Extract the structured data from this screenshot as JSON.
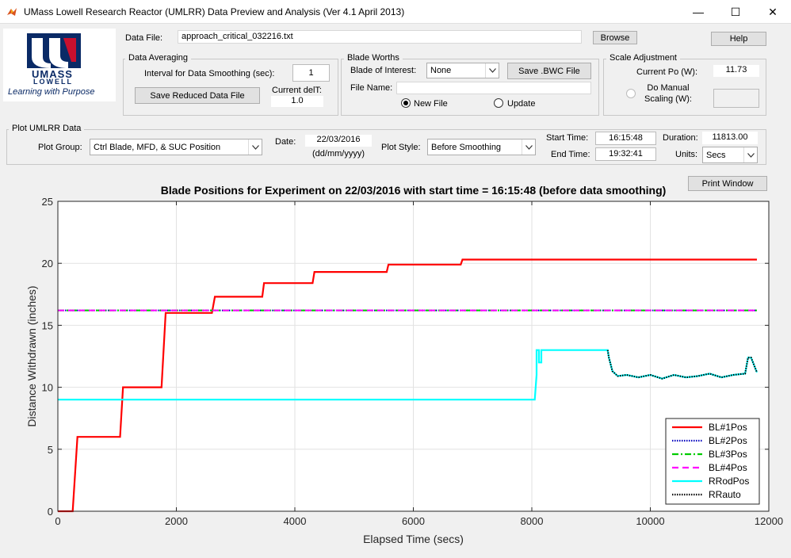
{
  "window": {
    "title": "UMass Lowell Research Reactor (UMLRR) Data Preview and Analysis (Ver 4.1 April 2013)",
    "minimize": "—",
    "maximize": "☐",
    "close": "✕"
  },
  "logo": {
    "text_top": "UMASS",
    "text_bottom": "LOWELL",
    "tagline": "Learning with Purpose"
  },
  "data_file": {
    "label": "Data File:",
    "value": "approach_critical_032216.txt",
    "browse": "Browse",
    "help": "Help"
  },
  "data_averaging": {
    "title": "Data Averaging",
    "interval_label": "Interval for Data Smoothing (sec):",
    "interval_value": "1",
    "save_button": "Save Reduced Data File",
    "current_delt_label": "Current delT:",
    "current_delt_value": "1.0"
  },
  "blade_worths": {
    "title": "Blade Worths",
    "blade_label": "Blade of Interest:",
    "blade_value": "None",
    "save_bwc": "Save .BWC File",
    "file_name_label": "File Name:",
    "file_name_value": "",
    "new_file": "New File",
    "update": "Update"
  },
  "scale_adjustment": {
    "title": "Scale Adjustment",
    "current_po_label": "Current Po (W):",
    "current_po_value": "11.73",
    "manual_label_1": "Do Manual",
    "manual_label_2": "Scaling (W):",
    "manual_value": ""
  },
  "plot_umlrr": {
    "title": "Plot UMLRR Data",
    "plot_group_label": "Plot Group:",
    "plot_group_value": "Ctrl Blade, MFD, & SUC Position",
    "date_label": "Date:",
    "date_value": "22/03/2016",
    "date_format": "(dd/mm/yyyy)",
    "plot_style_label": "Plot Style:",
    "plot_style_value": "Before Smoothing",
    "start_time_label": "Start Time:",
    "start_time_value": "16:15:48",
    "end_time_label": "End Time:",
    "end_time_value": "19:32:41",
    "duration_label": "Duration:",
    "duration_value": "11813.00",
    "units_label": "Units:",
    "units_value": "Secs",
    "print_window": "Print Window"
  },
  "icons": [
    "matlab-app-icon",
    "chevron-down-icon",
    "radio-icon"
  ],
  "chart_data": {
    "type": "line",
    "title": "Blade Positions for Experiment on 22/03/2016 with start time = 16:15:48 (before data smoothing)",
    "xlabel": "Elapsed Time (secs)",
    "ylabel": "Distance Withdrawn (inches)",
    "xlim": [
      0,
      12000
    ],
    "ylim": [
      0,
      25
    ],
    "xticks": [
      0,
      2000,
      4000,
      6000,
      8000,
      10000,
      12000
    ],
    "yticks": [
      0,
      5,
      10,
      15,
      20,
      25
    ],
    "grid": true,
    "legend_position": "bottom-right",
    "series": [
      {
        "name": "BL#1Pos",
        "color": "#ff0000",
        "style": "solid",
        "x": [
          0,
          250,
          330,
          1050,
          1100,
          1750,
          1820,
          2600,
          2650,
          3450,
          3480,
          4300,
          4330,
          5550,
          5580,
          6800,
          6830,
          11800
        ],
        "y": [
          0,
          0,
          6,
          6,
          10,
          10,
          16,
          16,
          17.3,
          17.3,
          18.4,
          18.4,
          19.3,
          19.3,
          19.9,
          19.9,
          20.3,
          20.3
        ]
      },
      {
        "name": "BL#2Pos",
        "color": "#0000c0",
        "style": "dotted",
        "x": [
          0,
          11800
        ],
        "y": [
          16.2,
          16.2
        ]
      },
      {
        "name": "BL#3Pos",
        "color": "#00cc00",
        "style": "dashdot",
        "x": [
          0,
          11800
        ],
        "y": [
          16.2,
          16.2
        ]
      },
      {
        "name": "BL#4Pos",
        "color": "#ff00ff",
        "style": "dashed",
        "x": [
          0,
          11800
        ],
        "y": [
          16.2,
          16.2
        ]
      },
      {
        "name": "RRodPos",
        "color": "#00ffff",
        "style": "solid",
        "x": [
          0,
          8050,
          8080,
          8080,
          8120,
          8120,
          8160,
          8160,
          8200,
          8200,
          9280,
          9300,
          9360,
          9450,
          9600,
          9800,
          10000,
          10200,
          10400,
          10600,
          10800,
          11000,
          11200,
          11400,
          11600,
          11650,
          11700,
          11800
        ],
        "y": [
          9,
          9,
          11,
          13,
          13,
          12,
          12,
          13,
          13,
          13,
          13,
          12.4,
          11.3,
          10.9,
          11.0,
          10.8,
          11.0,
          10.7,
          11.0,
          10.8,
          10.9,
          11.1,
          10.8,
          11.0,
          11.1,
          12.4,
          12.4,
          11.2
        ]
      },
      {
        "name": "RRauto",
        "color": "#000000",
        "style": "dotted",
        "x": [
          9280,
          9300,
          9360,
          9450,
          9600,
          9800,
          10000,
          10200,
          10400,
          10600,
          10800,
          11000,
          11200,
          11400,
          11600,
          11650,
          11700,
          11800
        ],
        "y": [
          13,
          12.4,
          11.3,
          10.9,
          11.0,
          10.8,
          11.0,
          10.7,
          11.0,
          10.8,
          10.9,
          11.1,
          10.8,
          11.0,
          11.1,
          12.4,
          12.4,
          11.2
        ]
      }
    ]
  }
}
